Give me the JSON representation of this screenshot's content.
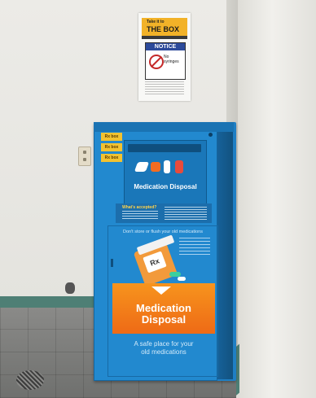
{
  "notice": {
    "brand_top": "Take it to",
    "brand_main": "THE BOX",
    "heading": "NOTICE",
    "sign_text": "No syringes"
  },
  "bin": {
    "stickers": [
      "Rx box",
      "Rx box",
      "Rx box"
    ],
    "slot_title": "Medication Disposal",
    "accept_title": "What's accepted?",
    "door_caption": "Don't store or flush your old medications",
    "bottle_label": "Rx",
    "band_title_line1": "Medication",
    "band_title_line2": "Disposal",
    "tagline_line1": "A safe place for your",
    "tagline_line2": "old medications"
  },
  "colors": {
    "bin_blue": "#2289cf",
    "band_orange": "#f7941d",
    "baseboard_green": "#4e7f75",
    "notice_yellow": "#f2b228"
  }
}
